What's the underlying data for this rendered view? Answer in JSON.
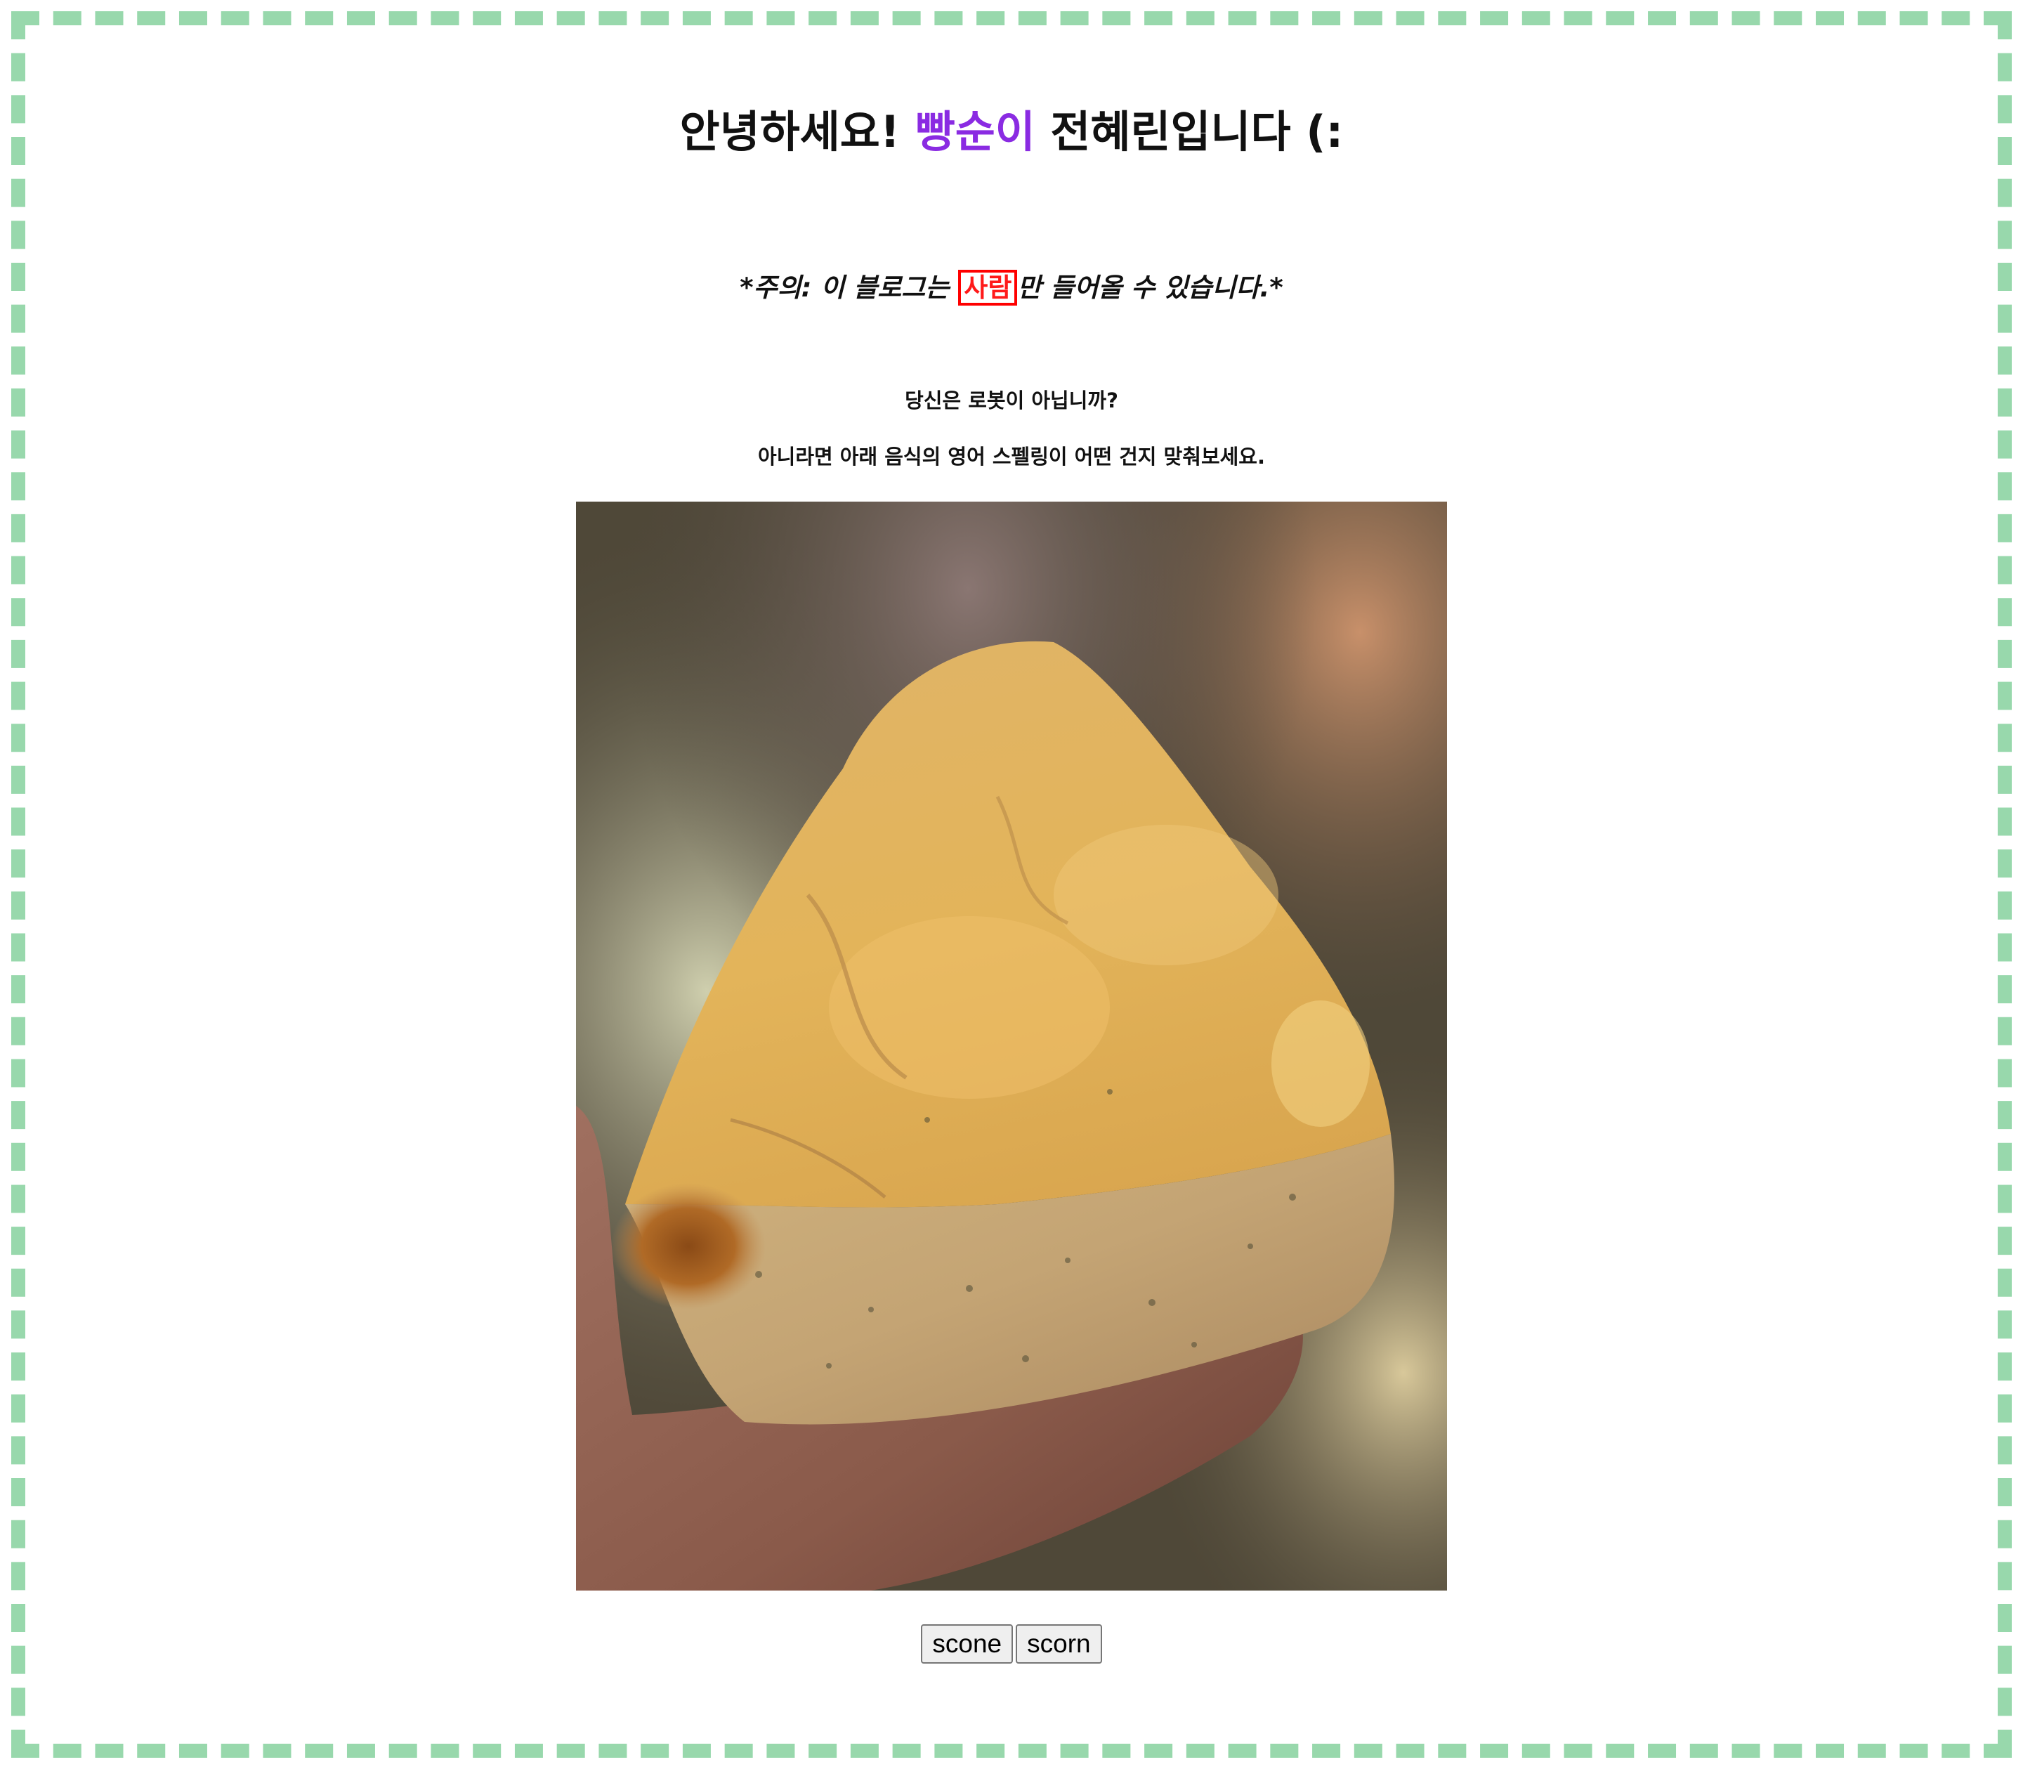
{
  "heading": {
    "prefix": "안녕하세요! ",
    "nickname": "빵순이",
    "suffix": " 전혜린입니다 (:"
  },
  "notice": {
    "before": "*주의: 이 블로그는 ",
    "highlight": "사람",
    "after": "만 들어올 수 있습니다.*"
  },
  "captcha": {
    "question": "당신은 로봇이 아닙니까?",
    "instruction": "아니라면 아래 음식의 영어 스펠링이 어떤 건지 맞춰보세요.",
    "options": [
      "scone",
      "scorn"
    ]
  },
  "colors": {
    "frame_border": "#98d8ac",
    "nickname": "#8a2be2",
    "highlight": "#ff1a1a"
  }
}
